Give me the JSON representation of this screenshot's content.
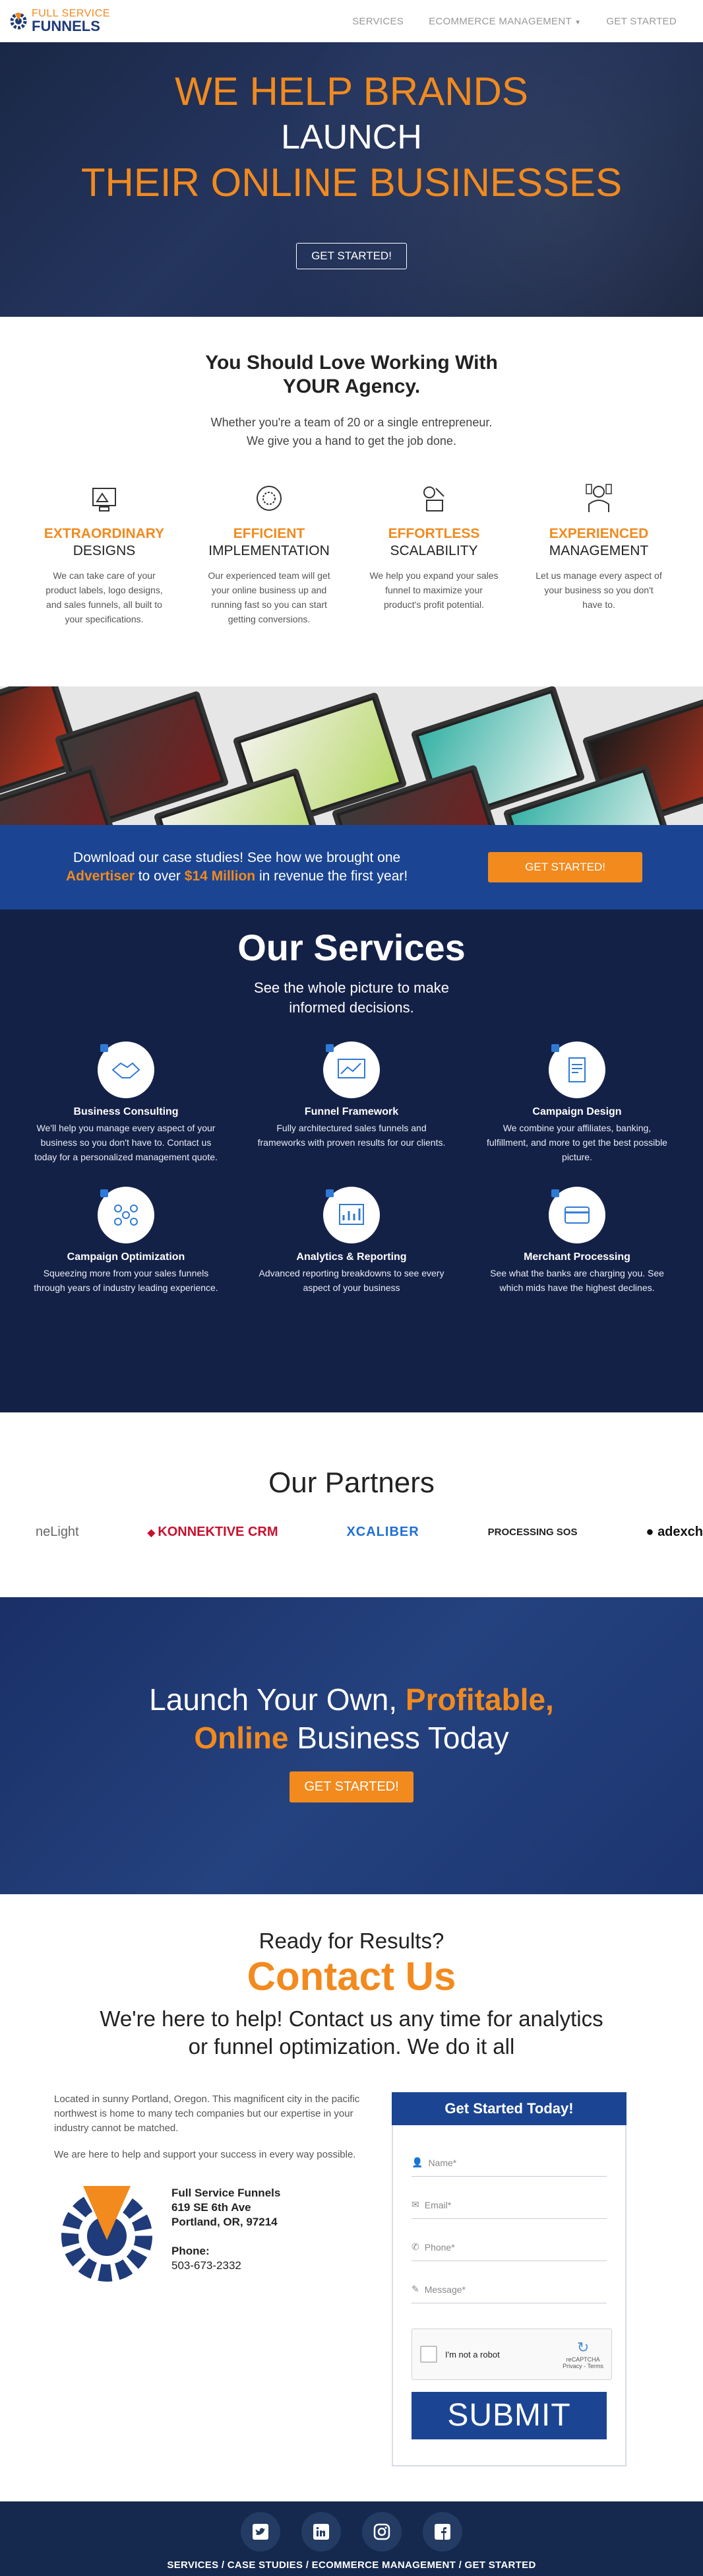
{
  "nav": {
    "logo_top": "FULL SERVICE",
    "logo_bottom": "FUNNELS",
    "links": [
      "SERVICES",
      "ECOMMERCE MANAGEMENT",
      "GET STARTED"
    ]
  },
  "hero": {
    "line1": "WE HELP BRANDS",
    "line2": "LAUNCH",
    "line3": "THEIR ONLINE BUSINESSES",
    "button": "GET STARTED!"
  },
  "why": {
    "title1": "You Should Love Working With",
    "title2": "YOUR Agency.",
    "sub1": "Whether you're a team of 20 or a single entrepreneur.",
    "sub2": "We give you a hand to get the job done.",
    "features": [
      {
        "t1": "EXTRAORDINARY",
        "t2": "DESIGNS",
        "desc": "We can take care of your product labels, logo designs, and sales funnels, all built to your specifications."
      },
      {
        "t1": "EFFICIENT",
        "t2": "IMPLEMENTATION",
        "desc": "Our experienced team will get your online business up and running fast so you can start getting conversions."
      },
      {
        "t1": "EFFORTLESS",
        "t2": "SCALABILITY",
        "desc": "We help you expand your sales funnel to maximize your product's profit potential."
      },
      {
        "t1": "EXPERIENCED",
        "t2": "MANAGEMENT",
        "desc": "Let us manage every aspect of your business so you don't have to."
      }
    ]
  },
  "band": {
    "line1": "Download our case studies! See how we brought one",
    "hl1": "Advertiser",
    "mid": " to over ",
    "hl2": "$14 Million",
    "end": " in revenue the first year!",
    "button": "GET STARTED!"
  },
  "services": {
    "title": "Our Services",
    "sub1": "See the whole picture to make",
    "sub2": "informed decisions.",
    "items": [
      {
        "name": "Business Consulting",
        "desc": "We'll help you manage every aspect of your business so you don't have to. Contact us today for a personalized management quote."
      },
      {
        "name": "Funnel Framework",
        "desc": "Fully architectured sales funnels and frameworks with proven results for our clients."
      },
      {
        "name": "Campaign Design",
        "desc": "We combine your affiliates, banking, fulfillment, and more to get the best possible picture."
      },
      {
        "name": "Campaign Optimization",
        "desc": "Squeezing more from your sales funnels through years of industry leading experience."
      },
      {
        "name": "Analytics & Reporting",
        "desc": "Advanced reporting breakdowns to see every aspect of your business"
      },
      {
        "name": "Merchant Processing",
        "desc": "See what the banks are charging you. See which mids have the highest declines."
      }
    ]
  },
  "partners": {
    "title": "Our Partners",
    "logos": [
      "neLight",
      "KONNEKTIVE CRM",
      "XCALIBER",
      "PROCESSING SOS",
      "adexch"
    ]
  },
  "launch": {
    "a": "Launch Your Own, ",
    "b": "Profitable,",
    "c": "Online",
    "d": " Business Today",
    "button": "GET STARTED!"
  },
  "contact": {
    "r1": "Ready for Results?",
    "r2": "Contact Us",
    "r3a": "We're here to help! Contact us any time for analytics",
    "r3b": "or funnel optimization. We do it all",
    "p1": "Located in sunny Portland, Oregon. This magnificent city in the pacific northwest is home to many tech companies but our expertise in your industry cannot be matched.",
    "p2": "We are here to help and support your success in every way possible.",
    "company": "Full Service Funnels",
    "street": "619 SE 6th Ave",
    "city": "Portland, OR, 97214",
    "phone_label": "Phone:",
    "phone": "503-673-2332"
  },
  "form": {
    "title": "Get Started Today!",
    "name": "Name*",
    "email": "Email*",
    "phone": "Phone*",
    "message": "Message*",
    "captcha": "I'm not a robot",
    "captcha_brand": "reCAPTCHA",
    "captcha_links": "Privacy - Terms",
    "submit": "SUBMIT"
  },
  "footer": {
    "links": "SERVICES / CASE STUDIES / ECOMMERCE MANAGEMENT / GET STARTED"
  }
}
